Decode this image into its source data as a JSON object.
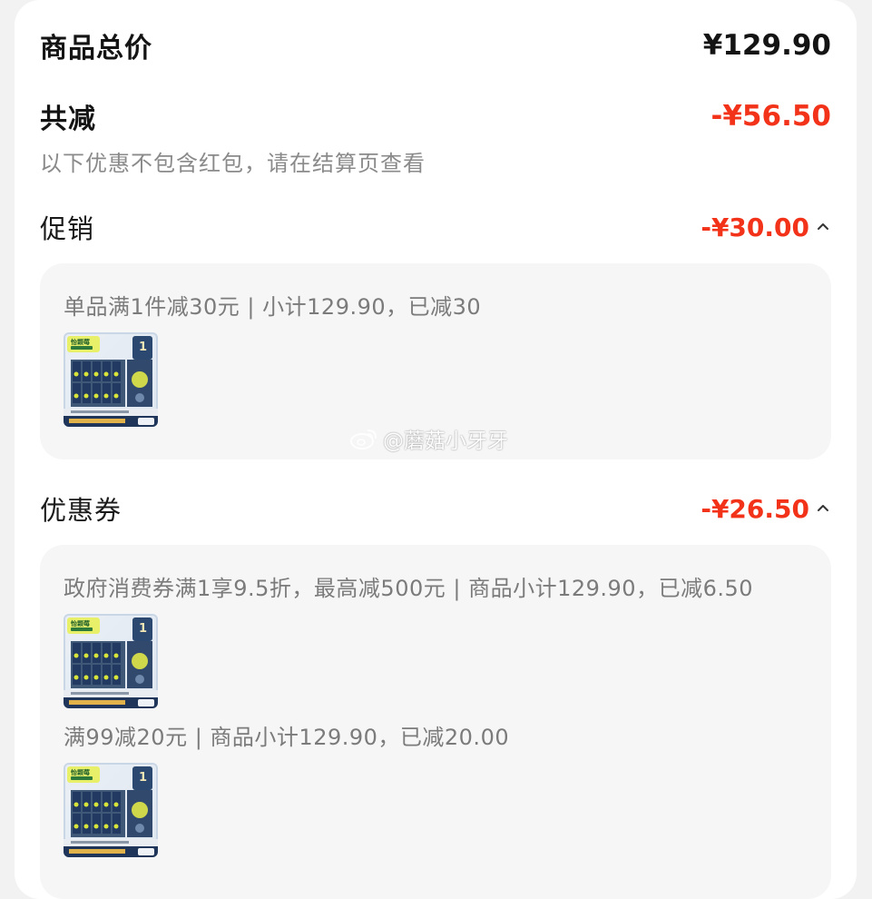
{
  "summary": {
    "total_label": "商品总价",
    "total_amount": "¥129.90",
    "reduce_label": "共减",
    "reduce_amount": "-¥56.50",
    "note": "以下优惠不包含红包，请在结算页查看"
  },
  "promotion": {
    "label": "促销",
    "amount": "-¥30.00",
    "rule": "单品满1件减30元 | 小计129.90，已减30"
  },
  "coupons": {
    "label": "优惠券",
    "amount": "-¥26.50",
    "items": [
      {
        "rule": "政府消费券满1享9.5折，最高减500元 | 商品小计129.90，已减6.50"
      },
      {
        "rule": "满99减20元 | 商品小计129.90，已减20.00"
      }
    ]
  },
  "watermark": {
    "text": "@蘑菇小牙牙",
    "icon": "weibo-icon"
  },
  "product_image": {
    "icon": "product-thumbnail",
    "brand": "怡颗莓",
    "badge": "1"
  },
  "colors": {
    "discount_red": "#f2331a",
    "panel_bg": "#f6f6f6",
    "muted_text": "#8a8a8a"
  }
}
